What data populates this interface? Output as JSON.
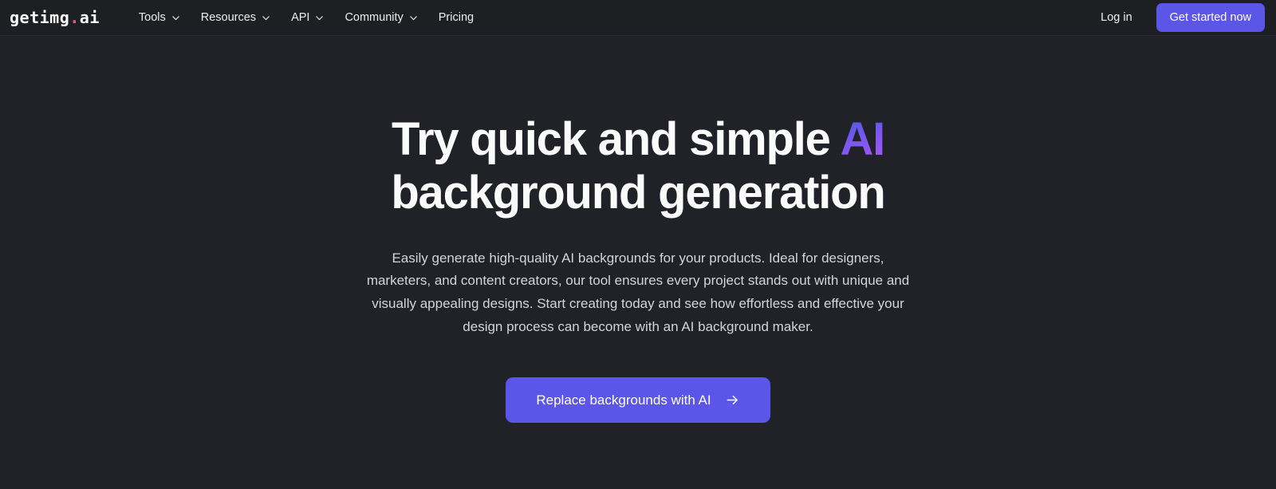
{
  "colors": {
    "page_bg": "#212227",
    "header_bg": "#1e1f22",
    "accent": "#5b55e8",
    "logo_dot": "#f2567a",
    "gradient_from": "#4f5ae9",
    "gradient_to": "#a855f7",
    "body_text": "#d3d4d8",
    "heading_text": "#fbfbfc"
  },
  "header": {
    "logo": {
      "name": "getimg",
      "dot": ".",
      "tld": "ai"
    },
    "nav": [
      {
        "label": "Tools",
        "has_dropdown": true,
        "icon": "chevron-down-icon"
      },
      {
        "label": "Resources",
        "has_dropdown": true,
        "icon": "chevron-down-icon"
      },
      {
        "label": "API",
        "has_dropdown": true,
        "icon": "chevron-down-icon"
      },
      {
        "label": "Community",
        "has_dropdown": true,
        "icon": "chevron-down-icon"
      },
      {
        "label": "Pricing",
        "has_dropdown": false,
        "icon": ""
      }
    ],
    "login_label": "Log in",
    "signup_label": "Get started now"
  },
  "hero": {
    "title_line1_plain": "Try quick and simple ",
    "title_line1_accent": "AI",
    "title_line2": "background generation",
    "subtitle": "Easily generate high-quality AI backgrounds for your products. Ideal for designers, marketers, and content creators, our tool ensures every project stands out with unique and visually appealing designs. Start creating today and see how effortless and effective your design process can become with an AI background maker.",
    "cta_label": "Replace backgrounds with AI",
    "cta_icon": "arrow-right-icon"
  }
}
